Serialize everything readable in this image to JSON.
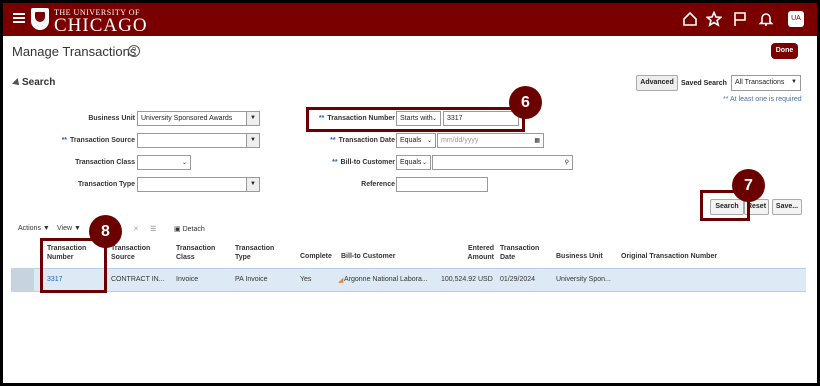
{
  "header": {
    "logo_small": "THE UNIVERSITY OF",
    "logo_big": "CHICAGO",
    "avatar": "UA",
    "icons": [
      "menu-icon",
      "home-icon",
      "star-icon",
      "flag-icon",
      "bell-icon"
    ]
  },
  "page": {
    "title": "Manage Transactions",
    "help": "?",
    "done": "Done"
  },
  "search": {
    "header": "Search",
    "advanced": "Advanced",
    "saved_search_label": "Saved Search",
    "saved_search_value": "All Transactions",
    "required_note": "** At least one is required",
    "fields": {
      "business_unit_label": "Business Unit",
      "business_unit_value": "University Sponsored Awards",
      "transaction_source_label": "Transaction Source",
      "transaction_class_label": "Transaction Class",
      "transaction_type_label": "Transaction Type",
      "transaction_number_label": "Transaction Number",
      "transaction_number_op": "Starts with",
      "transaction_number_value": "3317",
      "transaction_date_label": "Transaction Date",
      "transaction_date_op": "Equals",
      "transaction_date_placeholder": "mm/dd/yyyy",
      "bill_to_customer_label": "Bill-to Customer",
      "bill_to_customer_op": "Equals",
      "reference_label": "Reference"
    },
    "req_mark": "**",
    "search_btn": "Search",
    "reset_btn": "Reset",
    "save_btn": "Save..."
  },
  "callouts": {
    "c6": "6",
    "c7": "7",
    "c8": "8"
  },
  "results": {
    "actions": "Actions",
    "view": "View",
    "detach": "Detach",
    "columns": [
      "Transaction Number",
      "Transaction Source",
      "Transaction Class",
      "Transaction Type",
      "Complete",
      "Bill-to Customer",
      "Entered Amount",
      "Transaction Date",
      "Business Unit",
      "Original Transaction Number"
    ],
    "rows": [
      {
        "number": "3317",
        "source": "CONTRACT IN...",
        "class": "Invoice",
        "type": "PA Invoice",
        "complete": "Yes",
        "customer": "Argonne National Labora...",
        "amount": "100,524.92 USD",
        "date": "01/29/2024",
        "business_unit": "University Spon..."
      }
    ]
  }
}
